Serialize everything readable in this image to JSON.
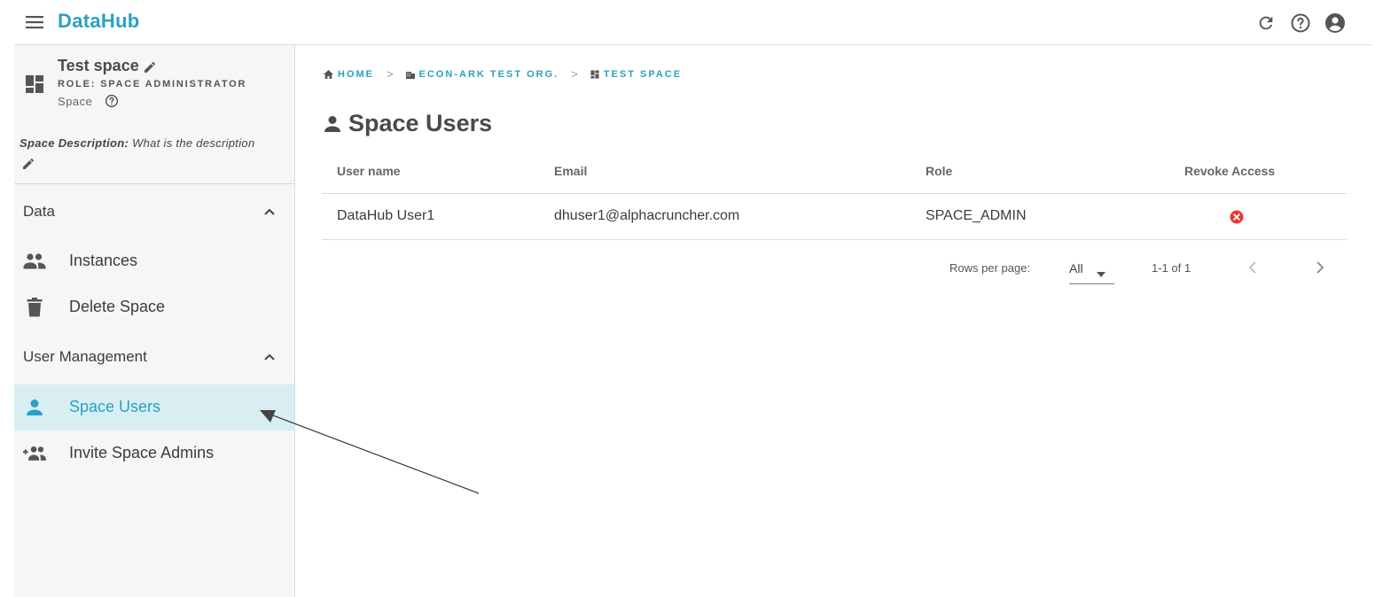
{
  "app": {
    "title": "DataHub"
  },
  "topbar": {
    "menu_icon": "hamburger-menu-icon",
    "icons": [
      "refresh-icon",
      "help-circle-icon",
      "account-circle-icon"
    ]
  },
  "space": {
    "name": "Test space",
    "role": "ROLE: SPACE ADMINISTRATOR",
    "type": "Space",
    "description_label": "Space Description:",
    "description_text": " What is the description"
  },
  "sidebar": {
    "sections": [
      {
        "label": "Data",
        "items": [
          {
            "label": "Instances",
            "icon": "people-icon"
          },
          {
            "label": "Delete Space",
            "icon": "trash-icon"
          }
        ]
      },
      {
        "label": "User Management",
        "items": [
          {
            "label": "Space Users",
            "icon": "person-icon",
            "active": true
          },
          {
            "label": "Invite Space Admins",
            "icon": "group-add-icon"
          }
        ]
      }
    ]
  },
  "breadcrumb": [
    {
      "label": "HOME",
      "icon": "home-icon"
    },
    {
      "label": "ECON-ARK TEST ORG.",
      "icon": "building-icon"
    },
    {
      "label": "TEST SPACE",
      "icon": "dashboard-icon"
    }
  ],
  "breadcrumb_separator": ">",
  "page": {
    "title": "Space Users",
    "icon": "person-icon"
  },
  "table": {
    "columns": [
      "User name",
      "Email",
      "Role",
      "Revoke Access"
    ],
    "rows": [
      {
        "user_name": "DataHub User1",
        "email": "dhuser1@alphacruncher.com",
        "role": "SPACE_ADMIN",
        "revoke_icon": "cancel-circle-icon"
      }
    ]
  },
  "pagination": {
    "rows_per_page_label": "Rows per page:",
    "rows_per_page_value": "All",
    "range": "1-1 of 1"
  },
  "colors": {
    "accent": "#2aa1c0",
    "active_bg": "#d8eef3",
    "sidebar_bg": "#f5f6f8",
    "revoke": "#e53935"
  }
}
